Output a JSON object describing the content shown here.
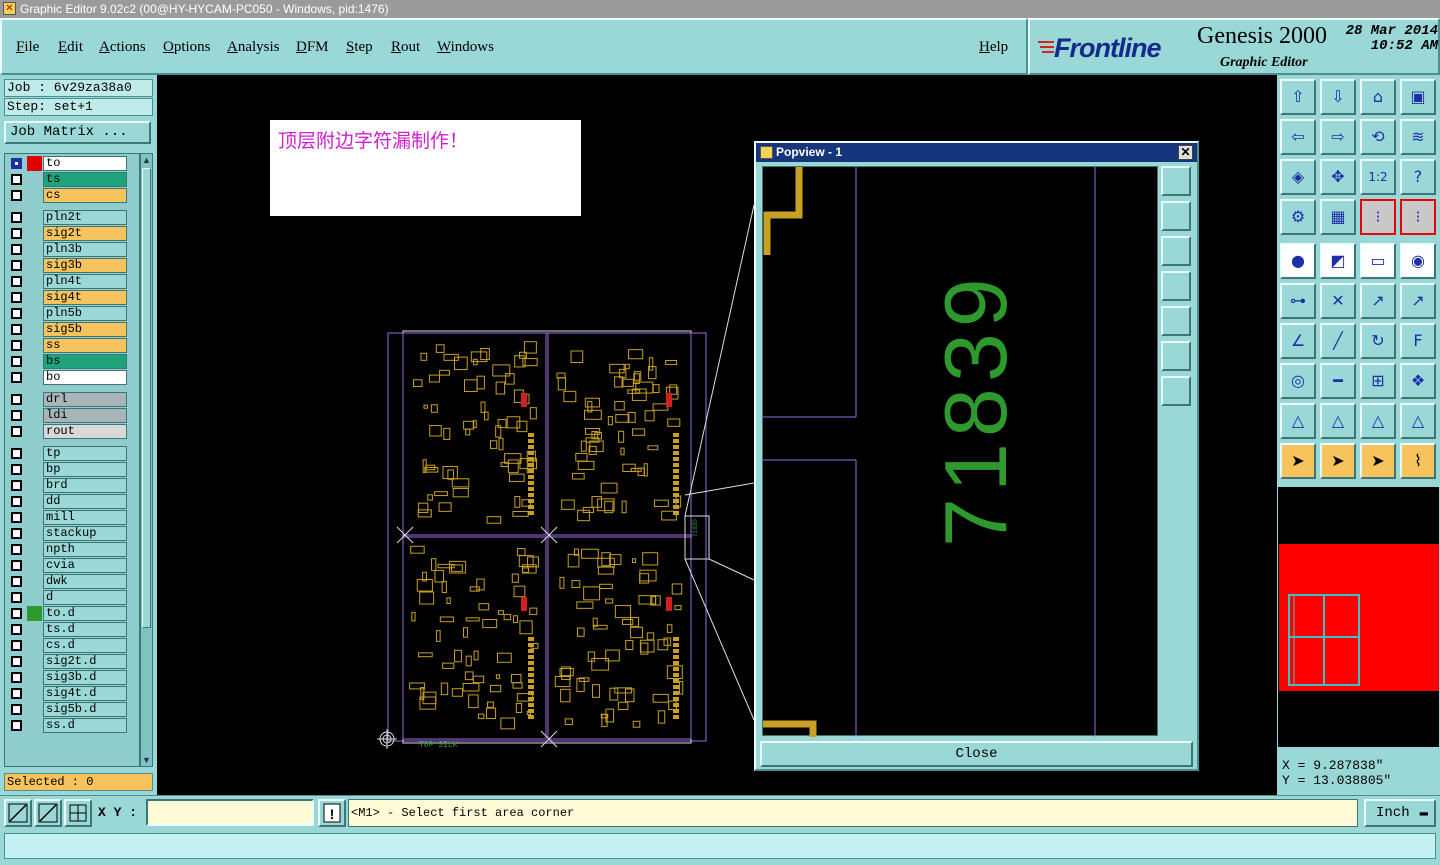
{
  "window": {
    "title": "Graphic Editor 9.02c2 (00@HY-HYCAM-PC050 - Windows, pid:1476)"
  },
  "menu": {
    "items": [
      "File",
      "Edit",
      "Actions",
      "Options",
      "Analysis",
      "DFM",
      "Step",
      "Rout",
      "Windows"
    ],
    "help": "Help"
  },
  "brand": {
    "logo": "Frontline",
    "product": "Genesis 2000",
    "subtitle": "Graphic Editor",
    "date": "28 Mar 2014",
    "time": "10:52 AM"
  },
  "job": {
    "job_label": "Job : 6v29za38a0",
    "step_label": "Step: set+1",
    "matrix_button": "Job Matrix ..."
  },
  "layers": [
    {
      "name": "to",
      "color": "#ffffff",
      "swatch": "#e00000",
      "active": true
    },
    {
      "name": "ts",
      "color": "#1fa37a",
      "swatch": ""
    },
    {
      "name": "cs",
      "color": "#f7c35c",
      "swatch": ""
    },
    {
      "name": "pln2t",
      "color": "#9ad7d7",
      "swatch": ""
    },
    {
      "name": "sig2t",
      "color": "#f7c35c",
      "swatch": ""
    },
    {
      "name": "pln3b",
      "color": "#9ad7d7",
      "swatch": ""
    },
    {
      "name": "sig3b",
      "color": "#f7c35c",
      "swatch": ""
    },
    {
      "name": "pln4t",
      "color": "#9ad7d7",
      "swatch": ""
    },
    {
      "name": "sig4t",
      "color": "#f7c35c",
      "swatch": ""
    },
    {
      "name": "pln5b",
      "color": "#9ad7d7",
      "swatch": ""
    },
    {
      "name": "sig5b",
      "color": "#f7c35c",
      "swatch": ""
    },
    {
      "name": "ss",
      "color": "#f7c35c",
      "swatch": ""
    },
    {
      "name": "bs",
      "color": "#1fa37a",
      "swatch": ""
    },
    {
      "name": "bo",
      "color": "#ffffff",
      "swatch": ""
    },
    {
      "name": "drl",
      "color": "#a9b4b8",
      "swatch": ""
    },
    {
      "name": "ldi",
      "color": "#a9b4b8",
      "swatch": ""
    },
    {
      "name": "rout",
      "color": "#d8d8d8",
      "swatch": ""
    },
    {
      "name": "tp",
      "color": "#9ad7d7",
      "swatch": ""
    },
    {
      "name": "bp",
      "color": "#9ad7d7",
      "swatch": ""
    },
    {
      "name": "brd",
      "color": "#9ad7d7",
      "swatch": ""
    },
    {
      "name": "dd",
      "color": "#9ad7d7",
      "swatch": ""
    },
    {
      "name": "mill",
      "color": "#9ad7d7",
      "swatch": ""
    },
    {
      "name": "stackup",
      "color": "#9ad7d7",
      "swatch": ""
    },
    {
      "name": "npth",
      "color": "#9ad7d7",
      "swatch": ""
    },
    {
      "name": "cvia",
      "color": "#9ad7d7",
      "swatch": ""
    },
    {
      "name": "dwk",
      "color": "#9ad7d7",
      "swatch": ""
    },
    {
      "name": "d",
      "color": "#9ad7d7",
      "swatch": ""
    },
    {
      "name": "to.d",
      "color": "#9ad7d7",
      "swatch": "#2e9a2e"
    },
    {
      "name": "ts.d",
      "color": "#9ad7d7",
      "swatch": ""
    },
    {
      "name": "cs.d",
      "color": "#9ad7d7",
      "swatch": ""
    },
    {
      "name": "sig2t.d",
      "color": "#9ad7d7",
      "swatch": ""
    },
    {
      "name": "sig3b.d",
      "color": "#9ad7d7",
      "swatch": ""
    },
    {
      "name": "sig4t.d",
      "color": "#9ad7d7",
      "swatch": ""
    },
    {
      "name": "sig5b.d",
      "color": "#9ad7d7",
      "swatch": ""
    },
    {
      "name": "ss.d",
      "color": "#9ad7d7",
      "swatch": ""
    }
  ],
  "selected": "Selected : 0",
  "note": "顶层附边字符漏制作！",
  "popview": {
    "title": "Popview - 1",
    "zoom_text": "71839",
    "close_button": "Close"
  },
  "coords": {
    "x": "X = 9.287838\"",
    "y": "Y = 13.038805\""
  },
  "bottom": {
    "xy_label": "X Y :",
    "xy_value": "",
    "message": "<M1> - Select first area corner",
    "unit": "Inch"
  },
  "colors": {
    "panel": "#9ad7d7",
    "accent_red": "#e00000",
    "layer_yellow": "#f7c35c",
    "board_yellow": "#c8a024",
    "board_outline": "#9a6ee0"
  }
}
